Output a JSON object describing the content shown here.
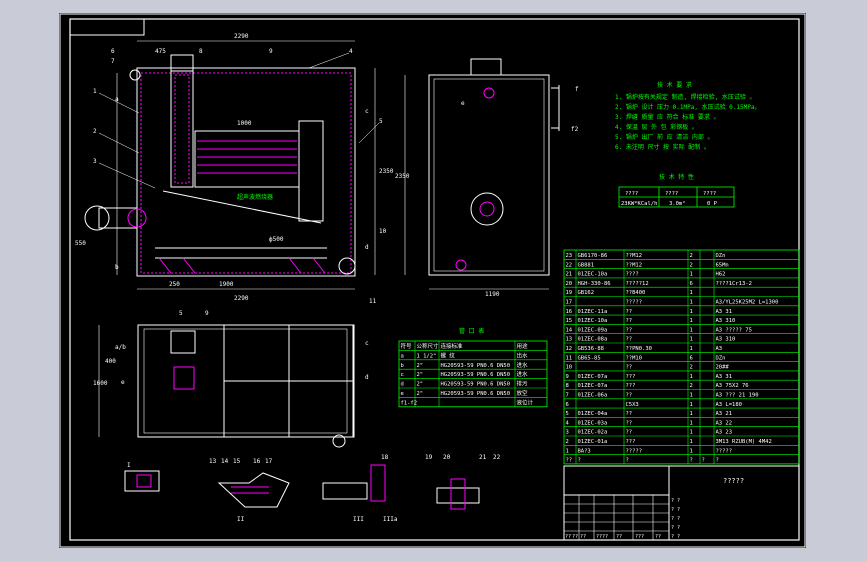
{
  "title_block": {
    "drawing_name": "?????"
  },
  "views": {
    "front": {
      "overall_width": "2290",
      "overall_height": "2350",
      "top_dim_a": "475",
      "tube_dim": "1000",
      "pipe_dim": "ф500",
      "base_dims": [
        "1900",
        "250",
        "2290"
      ],
      "fire_label": "超声波燃烧器",
      "left_height": "550",
      "side_letters": [
        "a",
        "b",
        "c",
        "d"
      ],
      "item_numbers": [
        "1",
        "2",
        "3",
        "4",
        "5",
        "6",
        "7",
        "8",
        "9",
        "10",
        "11"
      ]
    },
    "side": {
      "width": "1190",
      "height": "2350",
      "letters": [
        "e",
        "f",
        "f2"
      ]
    },
    "plan": {
      "letters": [
        "a/b",
        "c",
        "e",
        "d"
      ],
      "item_numbers": [
        "5",
        "9"
      ],
      "dims": [
        "1600",
        "400"
      ]
    },
    "details": {
      "labels": [
        "I",
        "II",
        "III",
        "IIIa"
      ],
      "item_numbers": [
        "13",
        "14",
        "15",
        "16",
        "17",
        "18",
        "19",
        "20",
        "21",
        "22"
      ]
    }
  },
  "notes": {
    "heading": "技 术 要 求",
    "lines": [
      "1. 锅炉按有关规定 制造, 焊接检验, 水压试验 。",
      "2. 锅炉 设计 压力 0.1MPa, 水压试验 0.15MPa。",
      "3. 焊缝 质量 应 符合 标准 要求 。",
      "4. 保温 层 外 包 彩钢板 。",
      "5. 锅炉 出厂 前 应 清洁 内部 。",
      "6. 未注明 尺寸 按 实际 配制 。"
    ]
  },
  "spec_table": {
    "heading": "技 术 特 性",
    "headers": [
      "????",
      "????",
      "????"
    ],
    "row": [
      "23KW*KCal/h",
      "3.0m²",
      "0 P"
    ]
  },
  "nozzle_table": {
    "heading": "管 口 表",
    "headers": [
      "符号",
      "公称尺寸",
      "连接标准",
      "用途"
    ],
    "rows": [
      [
        "a",
        "1 1/2\"",
        "螺 纹",
        "出水"
      ],
      [
        "b",
        "2\"",
        "HG20593-59 PN0.6 DN50",
        "进水"
      ],
      [
        "c",
        "2\"",
        "HG20593-59 PN0.6 DN50",
        "进水"
      ],
      [
        "d",
        "2\"",
        "HG20593-59 PN0.6 DN50",
        "排污"
      ],
      [
        "e",
        "2\"",
        "HG20593-59 PN0.6 DN50",
        "放空"
      ],
      [
        "f1-f2",
        "",
        "",
        "液位计"
      ]
    ]
  },
  "parts_list": {
    "rows": [
      [
        "23",
        "GB6170-86",
        "??M12",
        "2",
        "",
        "DZn"
      ],
      [
        "22",
        "GB881",
        "??M12",
        "2",
        "",
        "65Mn"
      ],
      [
        "21",
        "01ZEC-10a",
        "????",
        "1",
        "",
        "H62"
      ],
      [
        "20",
        "HGH-330-86",
        "?????12",
        "6",
        "",
        "????1Cr13-2"
      ],
      [
        "19",
        "GB162",
        "??B400",
        "1",
        "",
        ""
      ],
      [
        "17",
        "",
        "?????",
        "1",
        "",
        "A3/YL25K25M2   L=1300"
      ],
      [
        "16",
        "01ZEC-11a",
        "??",
        "1",
        "",
        "A3 31"
      ],
      [
        "15",
        "01ZEC-10a",
        "??",
        "1",
        "",
        "A3 310"
      ],
      [
        "14",
        "01ZEC-09a",
        "??",
        "1",
        "",
        "A3   ?????   75"
      ],
      [
        "13",
        "01ZEC-08a",
        "??",
        "1",
        "",
        "A3 310"
      ],
      [
        "12",
        "GB536-88",
        "??PN0.30",
        "1",
        "",
        "A3"
      ],
      [
        "11",
        "GB65-85",
        "??M10",
        "6",
        "",
        "DZn"
      ],
      [
        "10",
        "",
        "??",
        "2",
        "",
        "20##"
      ],
      [
        "9",
        "01ZEC-07a",
        "???",
        "1",
        "",
        "A3 31"
      ],
      [
        "8",
        "01ZEC-07a",
        "???",
        "2",
        "",
        "A3 75X2 76"
      ],
      [
        "7",
        "01ZEC-06a",
        "??",
        "1",
        "",
        "A3 ??? 21 190"
      ],
      [
        "6",
        "",
        "C5X3",
        "1",
        "",
        "A3       L=180"
      ],
      [
        "5",
        "01ZEC-04a",
        "??",
        "1",
        "",
        "A3 21"
      ],
      [
        "4",
        "01ZEC-03a",
        "??",
        "1",
        "",
        "A3 22"
      ],
      [
        "3",
        "01ZEC-02a",
        "??",
        "1",
        "",
        "A3 23"
      ],
      [
        "2",
        "01ZEC-01a",
        "???",
        "1",
        "",
        "3M13 RZUB(M) 4M42"
      ],
      [
        "1",
        "BA?3",
        "?????",
        "1",
        "",
        "?????"
      ],
      [
        "??",
        "?",
        "?",
        "?",
        "?",
        "?"
      ]
    ]
  },
  "title_rows": {
    "bottom": [
      "??",
      "??",
      "??",
      "????",
      "??",
      "???",
      "??"
    ],
    "right": [
      "? ?",
      "? ?",
      "? ?",
      "? ?",
      "? ?"
    ]
  },
  "colors": {
    "background": "#c9ccd6",
    "sheet": "#000000",
    "line": "#ffffff",
    "text": "#00ff00",
    "highlight": "#ff00ff",
    "accent": "#ffff00"
  }
}
